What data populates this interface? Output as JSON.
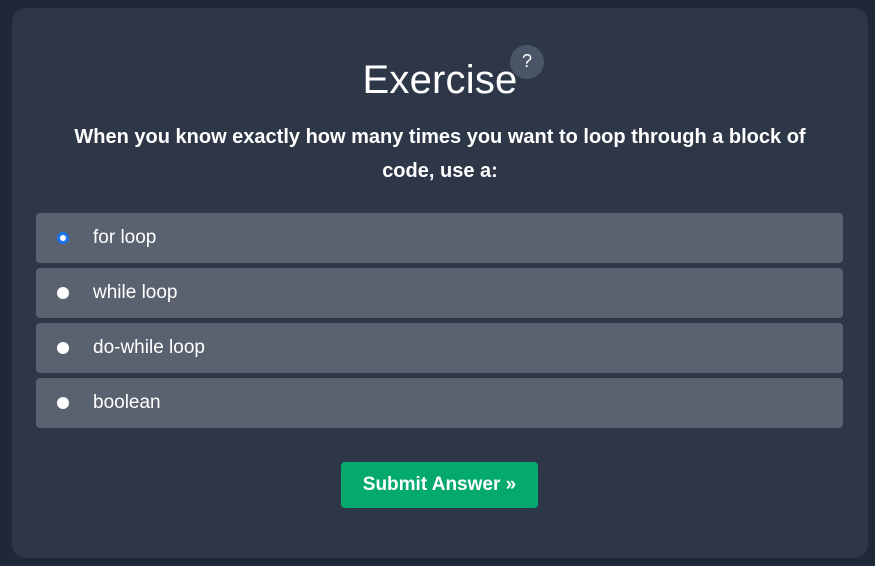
{
  "exercise": {
    "title": "Exercise",
    "help_icon": "question-mark-icon",
    "help_label": "?",
    "question": "When you know exactly how many times you want to loop through a block of code, use a:",
    "options": [
      {
        "label": "for loop",
        "selected": true
      },
      {
        "label": "while loop",
        "selected": false
      },
      {
        "label": "do-while loop",
        "selected": false
      },
      {
        "label": "boolean",
        "selected": false
      }
    ],
    "submit_label": "Submit Answer »"
  },
  "colors": {
    "background": "#1f2836",
    "card": "#2d3748",
    "option": "#5a6270",
    "accent_submit": "#04aa6d",
    "radio_selected": "#1a73e8"
  }
}
